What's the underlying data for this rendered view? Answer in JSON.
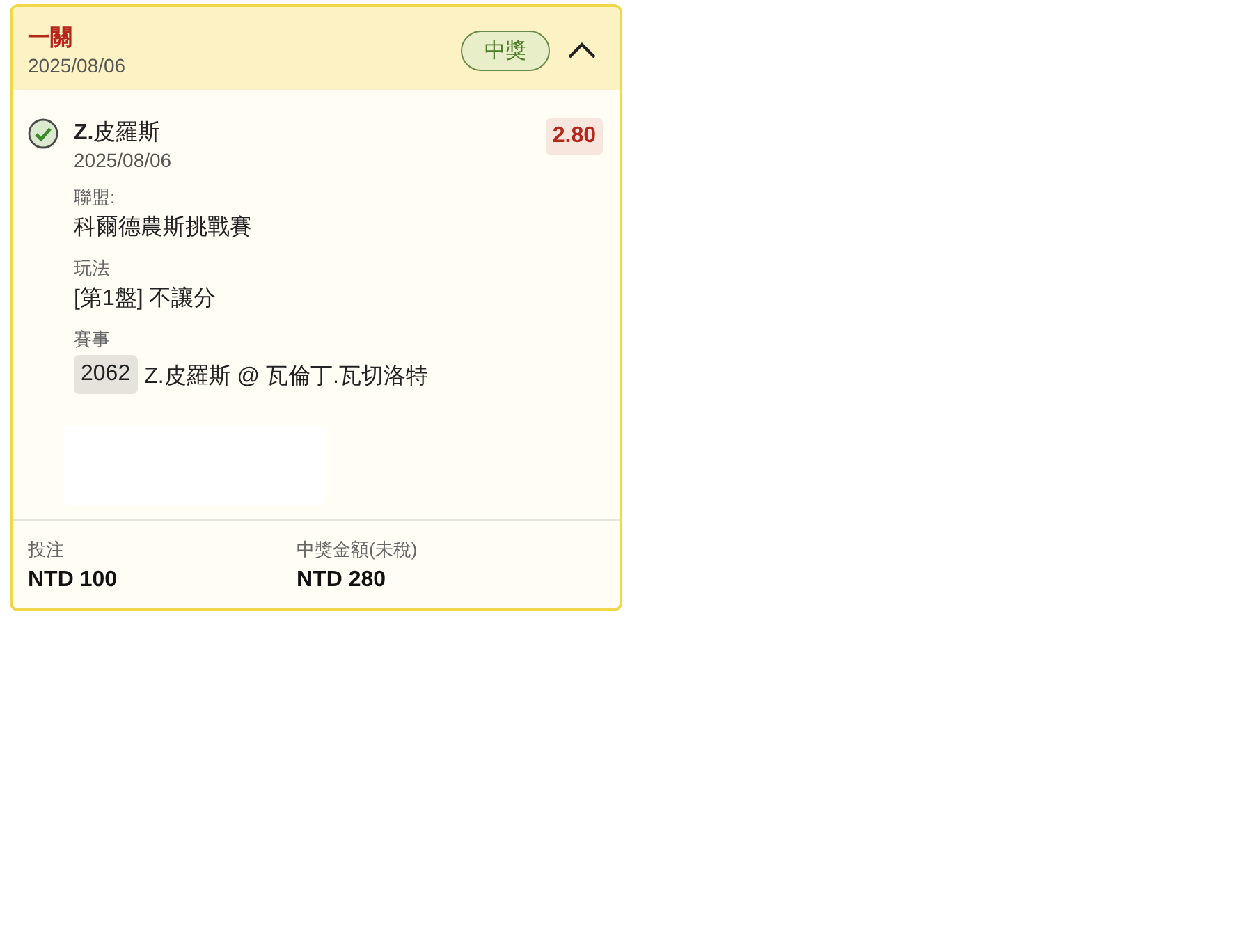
{
  "header": {
    "title": "一關",
    "date": "2025/08/06",
    "status": "中獎",
    "expanded": true
  },
  "selection": {
    "checked": true,
    "name": "**Z.**皮羅斯",
    "date": "2025/08/06",
    "odds": "2.80",
    "fields": [
      {
        "label": "聯盟:",
        "value": "科爾德農斯挑戰賽"
      },
      {
        "label": "玩法",
        "value": "[第1盤] 不讓分"
      }
    ],
    "match": {
      "label": "賽事",
      "code": "2062",
      "value": "Z.皮羅斯 @ 瓦倫丁.瓦切洛特"
    }
  },
  "footer": [
    {
      "label": "投注",
      "value": "NTD 100"
    },
    {
      "label": "中獎金額(未稅)",
      "value": "NTD 280"
    }
  ]
}
